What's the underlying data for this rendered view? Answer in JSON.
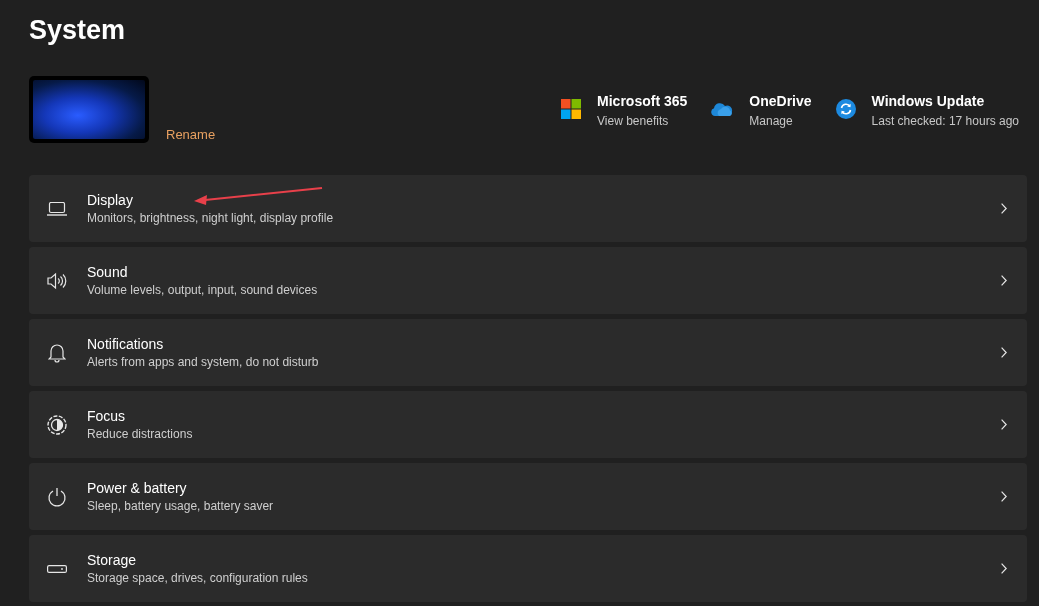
{
  "page_title": "System",
  "device": {
    "rename_link": "Rename"
  },
  "quick_links": [
    {
      "title": "Microsoft 365",
      "subtitle": "View benefits"
    },
    {
      "title": "OneDrive",
      "subtitle": "Manage"
    },
    {
      "title": "Windows Update",
      "subtitle": "Last checked: 17 hours ago"
    }
  ],
  "settings": [
    {
      "title": "Display",
      "subtitle": "Monitors, brightness, night light, display profile"
    },
    {
      "title": "Sound",
      "subtitle": "Volume levels, output, input, sound devices"
    },
    {
      "title": "Notifications",
      "subtitle": "Alerts from apps and system, do not disturb"
    },
    {
      "title": "Focus",
      "subtitle": "Reduce distractions"
    },
    {
      "title": "Power & battery",
      "subtitle": "Sleep, battery usage, battery saver"
    },
    {
      "title": "Storage",
      "subtitle": "Storage space, drives, configuration rules"
    }
  ]
}
